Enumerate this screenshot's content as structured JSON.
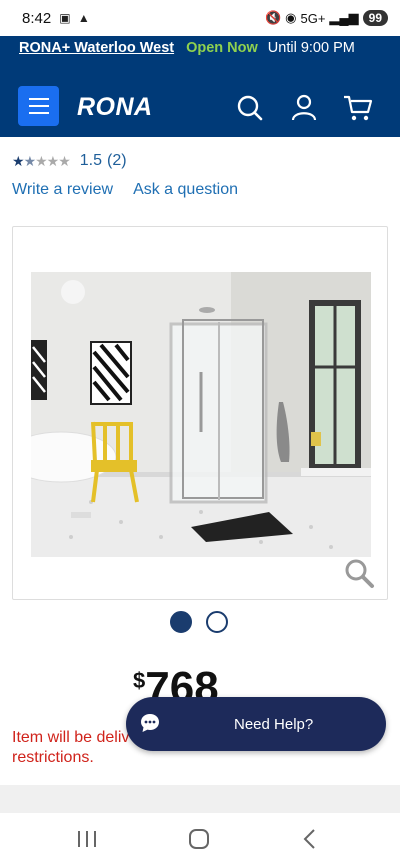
{
  "status": {
    "time": "8:42",
    "network": "5G+",
    "battery": "99"
  },
  "store": {
    "name": "RONA+ Waterloo West",
    "open": "Open Now",
    "hours": "Until 9:00 PM"
  },
  "header": {
    "logo": "RONA",
    "icons": [
      "menu-icon",
      "search-icon",
      "account-icon",
      "cart-icon"
    ]
  },
  "product": {
    "rating_value": "1.5",
    "rating_count": "(2)",
    "rating_fraction": 0.3,
    "links": {
      "review": "Write a review",
      "question": "Ask a question"
    },
    "gallery": {
      "slide_count": 2,
      "active_slide": 1
    },
    "price_currency": "$",
    "price_amount": "768",
    "notice": "Item will be deliv restrictions."
  },
  "help": {
    "label": "Need Help?"
  },
  "colors": {
    "brand_navy": "#003a78",
    "menu_blue": "#1a6ef0",
    "open_green": "#8fd14f",
    "link_blue": "#1f6fb3",
    "notice_red": "#d0231b",
    "help_navy": "#1d2a5a"
  }
}
